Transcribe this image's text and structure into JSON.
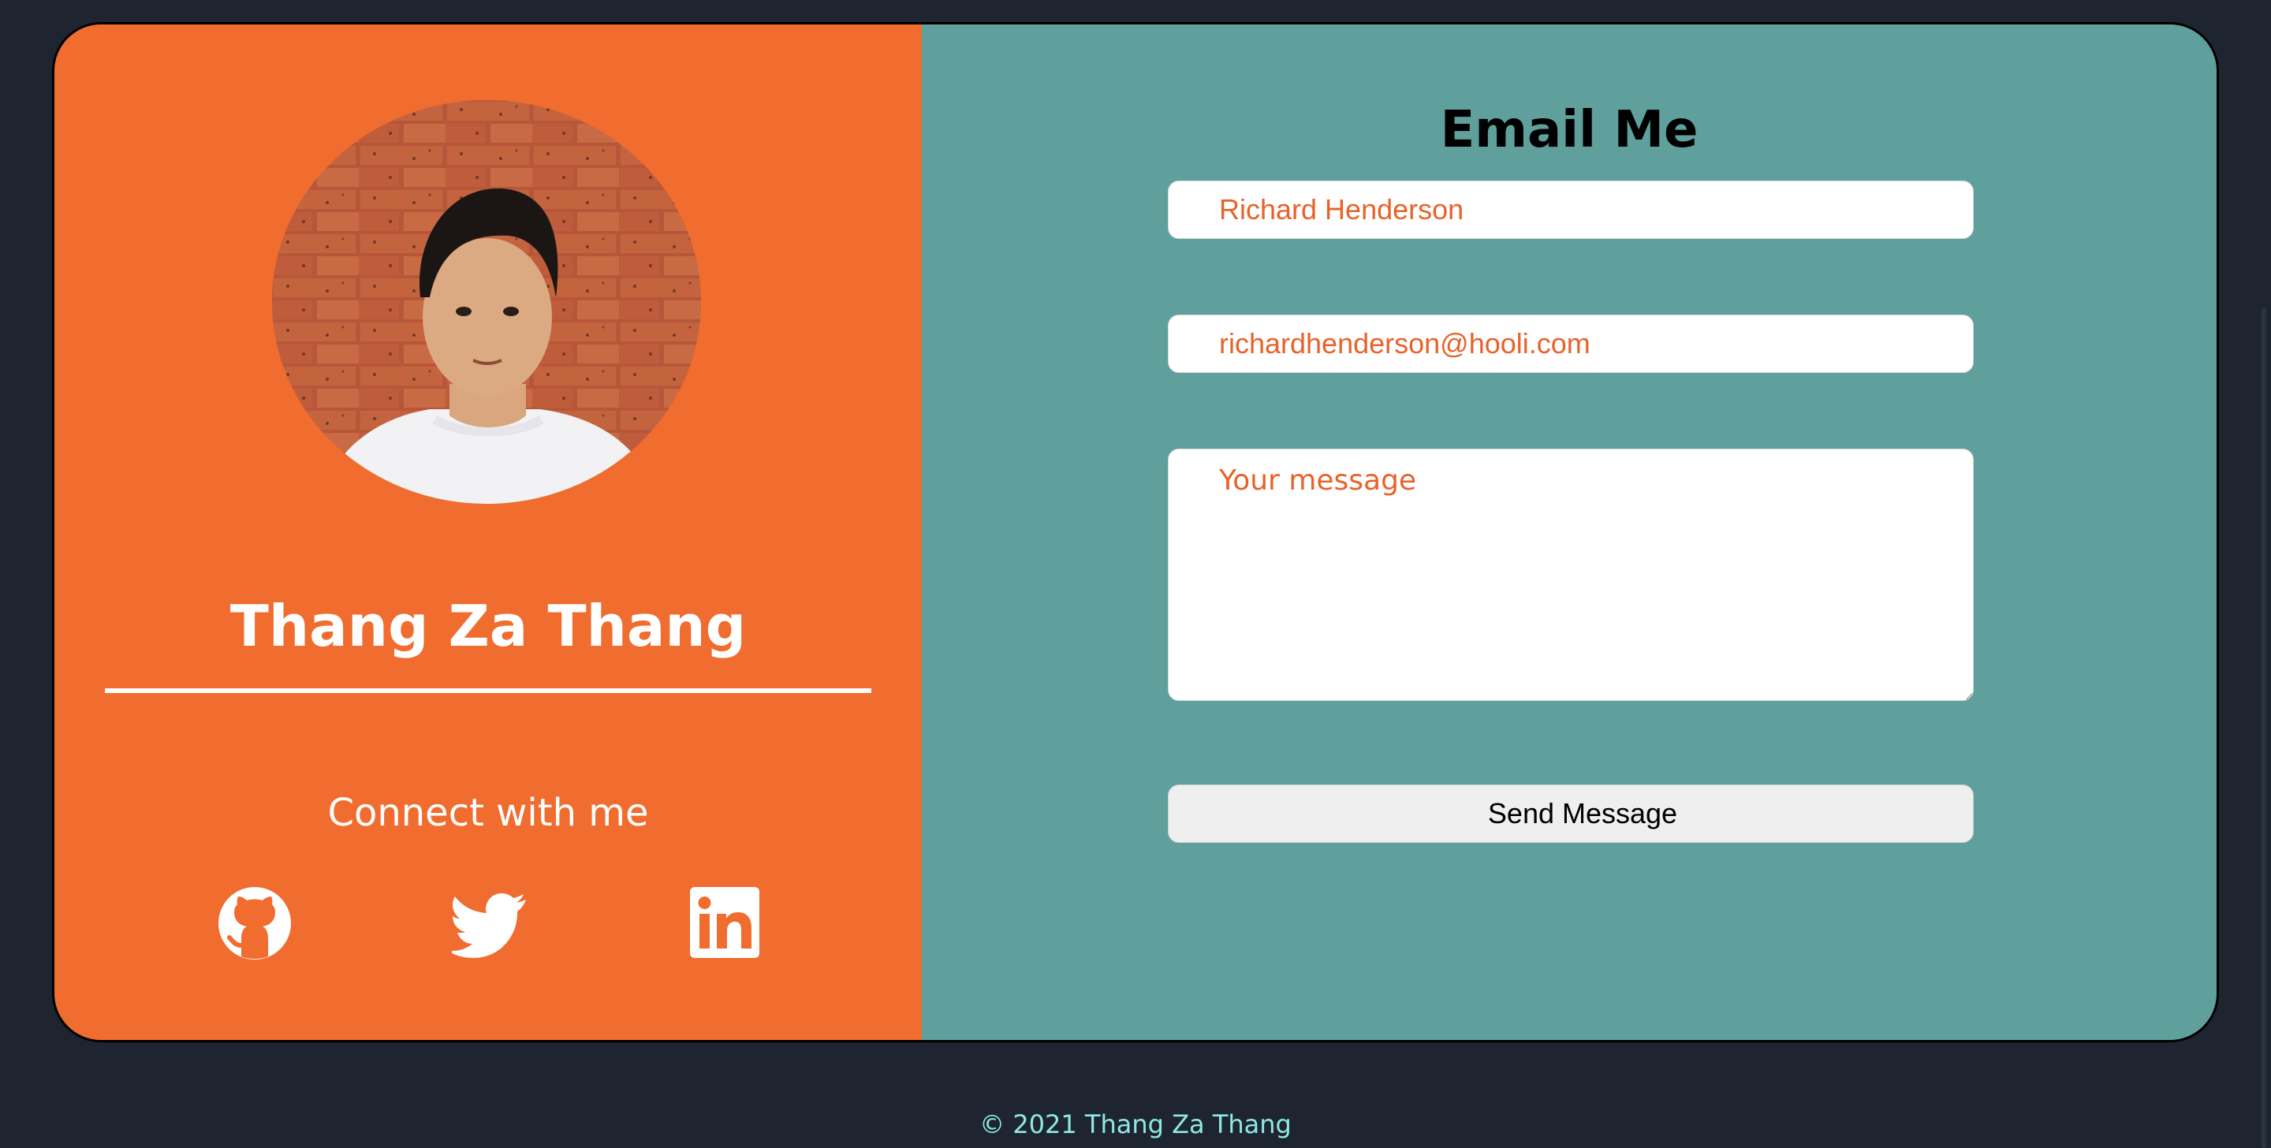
{
  "profile": {
    "name": "Thang Za Thang",
    "connect_label": "Connect with me",
    "photo_desc": "profile-photo"
  },
  "social": {
    "github_icon": "github-icon",
    "twitter_icon": "twitter-icon",
    "linkedin_icon": "linkedin-icon"
  },
  "form": {
    "title": "Email Me",
    "name_value": "Richard Henderson",
    "email_value": "richardhenderson@hooli.com",
    "message_placeholder": "Your message",
    "submit_label": "Send Message"
  },
  "footer": {
    "text": "© 2021 Thang Za Thang"
  },
  "colors": {
    "background": "#1f2530",
    "left_panel": "#f06c2f",
    "right_panel": "#5fa09d",
    "input_text": "#e8622a",
    "footer_text": "#8fe8e4"
  }
}
